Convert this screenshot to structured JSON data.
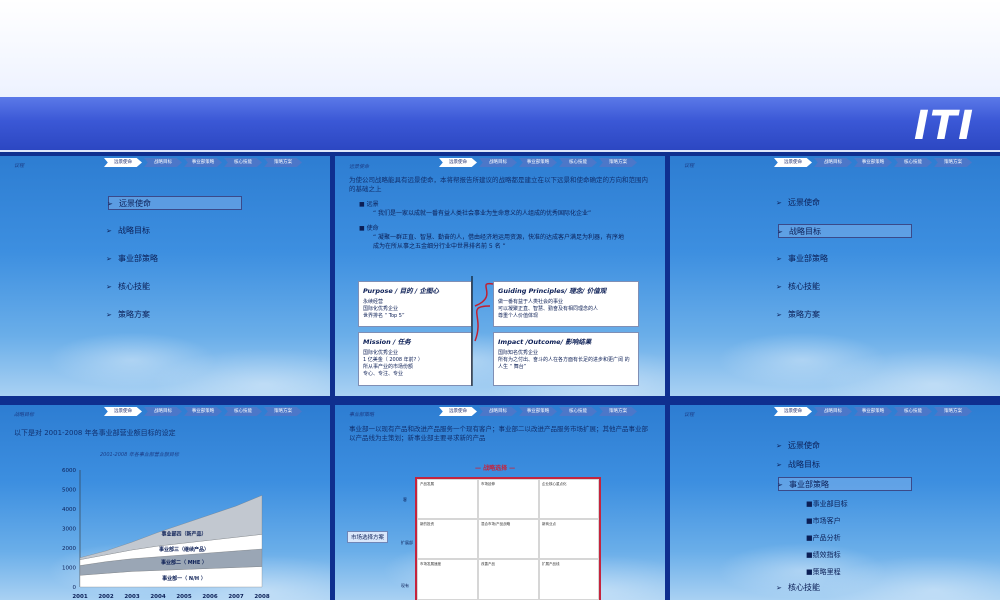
{
  "logo": "ITI",
  "tabs": [
    "远景使命",
    "战略目标",
    "事业部策略",
    "核心技能",
    "策略方案"
  ],
  "slide1": {
    "crumb": "议程",
    "menu": [
      "远景使命",
      "战略目标",
      "事业部策略",
      "核心技能",
      "策略方案"
    ],
    "selected": 0
  },
  "slide2": {
    "crumb": "远景使命",
    "intro": "为使公司战略能具有远景使命，本将帮报告所建议的战略都是建立在以下远景和使命确定的方向和范围内的基础之上",
    "vision_title": "远景",
    "vision_text": "“ 我们是一家以成就一番有益人类社会事业为生命意义的人组成的优秀国际化企业”",
    "mission_title": "使命",
    "mission_text": "“ 凝聚一群正直、智慧、勤奋的人，借由经济地运用资源，快准的达成客户满足为利器，有序地成为在所从事之五金细分行业中世界排名前 5 名 ”",
    "purpose": {
      "title": "Purpose / 目的 / 企图心",
      "lines": [
        "永续经营",
        "国际化优秀企业",
        "世界排名 “ Top 5”"
      ]
    },
    "principles": {
      "title": "Guiding Principles/ 理念/ 价值观",
      "lines": [
        "做一番有益于人类社会的事业",
        "可以凝聚正直、智慧、勤奋及有相同理念的人",
        "尊重个人价值体现"
      ]
    },
    "mission_box": {
      "title": "Mission / 任务",
      "lines": [
        "国际化优秀企业",
        "1 亿美金（ 2008 年前? ）",
        "所从事产业的市场份额",
        "专心、专注、专业"
      ]
    },
    "impact": {
      "title": "Impact /Outcome/ 影响结果",
      "lines": [
        "国际知名优秀企业",
        "所有为之付出、奋斗的人在各方面有长足的进步和更广阔 的人生 “ 舞台”"
      ]
    }
  },
  "slide3": {
    "crumb": "议程",
    "menu": [
      "远景使命",
      "战略目标",
      "事业部策略",
      "核心技能",
      "策略方案"
    ],
    "selected": 1
  },
  "slide4": {
    "crumb": "战略目标",
    "heading": "以下是对 2001-2008 年各事业部营业额目标的设定",
    "chart_title": "2001-2008 年各事业部营业额目标",
    "chart_data": {
      "type": "area",
      "x": [
        "2001",
        "2002",
        "2003",
        "2004",
        "2005",
        "2006",
        "2007",
        "2008"
      ],
      "ylim": [
        0,
        6000
      ],
      "yticks": [
        0,
        1000,
        2000,
        3000,
        4000,
        5000,
        6000
      ],
      "series": [
        {
          "name": "事业部一（ N/H ）",
          "values": [
            600,
            700,
            800,
            850,
            900,
            950,
            1000,
            1050
          ]
        },
        {
          "name": "事业部二（ MHE ）",
          "values": [
            500,
            600,
            650,
            700,
            750,
            800,
            850,
            900
          ]
        },
        {
          "name": "事业部三（继续产品）",
          "values": [
            300,
            350,
            450,
            550,
            600,
            650,
            700,
            750
          ]
        },
        {
          "name": "事业部四（新产品）",
          "values": [
            100,
            200,
            400,
            700,
            1000,
            1300,
            1600,
            2000
          ]
        }
      ]
    }
  },
  "slide5": {
    "crumb": "事业部策略",
    "heading": "事业部一以现有产品和改进产品服务一个现有客户；事业部二以改进产品服务市场扩展；其他产品事业部以产品线为主策划；新事业部主要寻求新的产品",
    "matrix_title": "— 战略选择 —",
    "side_label": "市场选择方案",
    "row_labels": [
      "客",
      "扩展部",
      "现有"
    ],
    "cells": [
      "产品发展",
      "市场延伸",
      "企业核心重点化",
      "新的投资",
      "混合市场/产品战略",
      "新商业点",
      "市场发展速度",
      "改善产品",
      "扩展产品线"
    ]
  },
  "slide6": {
    "crumb": "议程",
    "menu": [
      "远景使命",
      "战略目标",
      "事业部策略"
    ],
    "submenu": [
      "事业部目标",
      "市场客户",
      "产品分析",
      "绩效指标",
      "策略里程"
    ],
    "after": [
      "核心技能"
    ],
    "selected": 2
  }
}
